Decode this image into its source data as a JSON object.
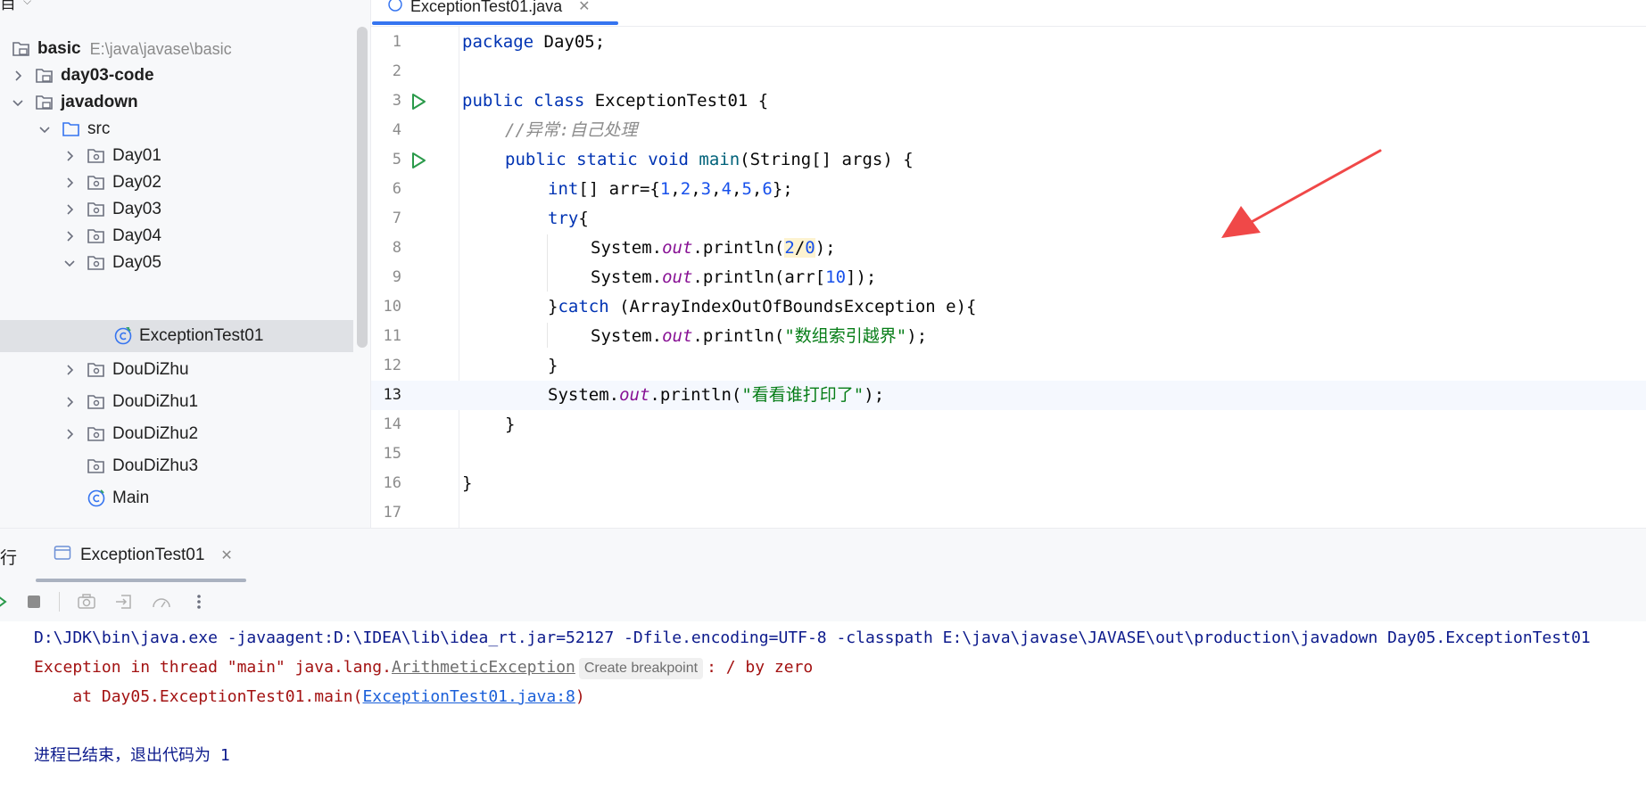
{
  "project": {
    "header_char": "目",
    "root": {
      "name": "basic",
      "path": "E:\\java\\javase\\basic"
    },
    "items": [
      {
        "label": "day03-code",
        "bold": true
      },
      {
        "label": "javadown",
        "bold": true
      },
      {
        "label": "src"
      },
      {
        "label": "Day01"
      },
      {
        "label": "Day02"
      },
      {
        "label": "Day03"
      },
      {
        "label": "Day04"
      },
      {
        "label": "Day05"
      },
      {
        "label": "ExceptionTest01"
      },
      {
        "label": "DouDiZhu"
      },
      {
        "label": "DouDiZhu1"
      },
      {
        "label": "DouDiZhu2"
      },
      {
        "label": "DouDiZhu3"
      },
      {
        "label": "Main"
      }
    ]
  },
  "editor": {
    "tab_title": "ExceptionTest01.java",
    "line_numbers": [
      "1",
      "2",
      "3",
      "4",
      "5",
      "6",
      "7",
      "8",
      "9",
      "10",
      "11",
      "12",
      "13",
      "14",
      "15",
      "16",
      "17"
    ],
    "code": {
      "l1": {
        "kw": "package",
        "rest": " Day05;"
      },
      "l3": {
        "kw1": "public",
        "kw2": "class",
        "name": " ExceptionTest01 {"
      },
      "l4": "//异常:自己处理",
      "l5": {
        "kw1": "public",
        "kw2": "static",
        "kw3": "void",
        "fn": "main",
        "rest": "(String[] args) {"
      },
      "l6": {
        "kw": "int",
        "rest": "[] arr={",
        "n1": "1",
        "n2": "2",
        "n3": "3",
        "n4": "4",
        "n5": "5",
        "n6": "6",
        "end": "};"
      },
      "l7": {
        "kw": "try",
        "rest": "{"
      },
      "l8": {
        "pre": "System.",
        "fld": "out",
        "mid": ".println(",
        "n1": "2",
        "slash": "/",
        "n2": "0",
        "end": ");"
      },
      "l9": {
        "pre": "System.",
        "fld": "out",
        "mid": ".println(arr[",
        "num": "10",
        "end": "]);"
      },
      "l10": {
        "pre": "}",
        "kw": "catch",
        "rest": " (ArrayIndexOutOfBoundsException e){"
      },
      "l11": {
        "pre": "System.",
        "fld": "out",
        "mid": ".println(",
        "str": "\"数组索引越界\"",
        "end": ");"
      },
      "l12": "}",
      "l13": {
        "pre": "System.",
        "fld": "out",
        "mid": ".println(",
        "str": "\"看看谁打印了\"",
        "end": ");"
      },
      "l14": "}",
      "l16": "}"
    }
  },
  "run": {
    "title": "行",
    "tab_label": "ExceptionTest01",
    "console": {
      "cmd": "D:\\JDK\\bin\\java.exe -javaagent:D:\\IDEA\\lib\\idea_rt.jar=52127 -Dfile.encoding=UTF-8 -classpath E:\\java\\javase\\JAVASE\\out\\production\\javadown Day05.ExceptionTest01",
      "err_prefix": "Exception in thread \"main\" java.lang.",
      "err_class": "ArithmeticException",
      "breakpoint_badge": "Create breakpoint",
      "err_suffix": ": / by zero",
      "at_prefix": "    at Day05.ExceptionTest01.main(",
      "at_link": "ExceptionTest01.java:8",
      "at_suffix": ")",
      "exit": "进程已结束，退出代码为 1"
    }
  },
  "colors": {
    "accent": "#3574f0",
    "keyword": "#0033b3",
    "string": "#067d17",
    "number": "#1750eb",
    "error": "#a31212",
    "arrow": "#f04848"
  }
}
